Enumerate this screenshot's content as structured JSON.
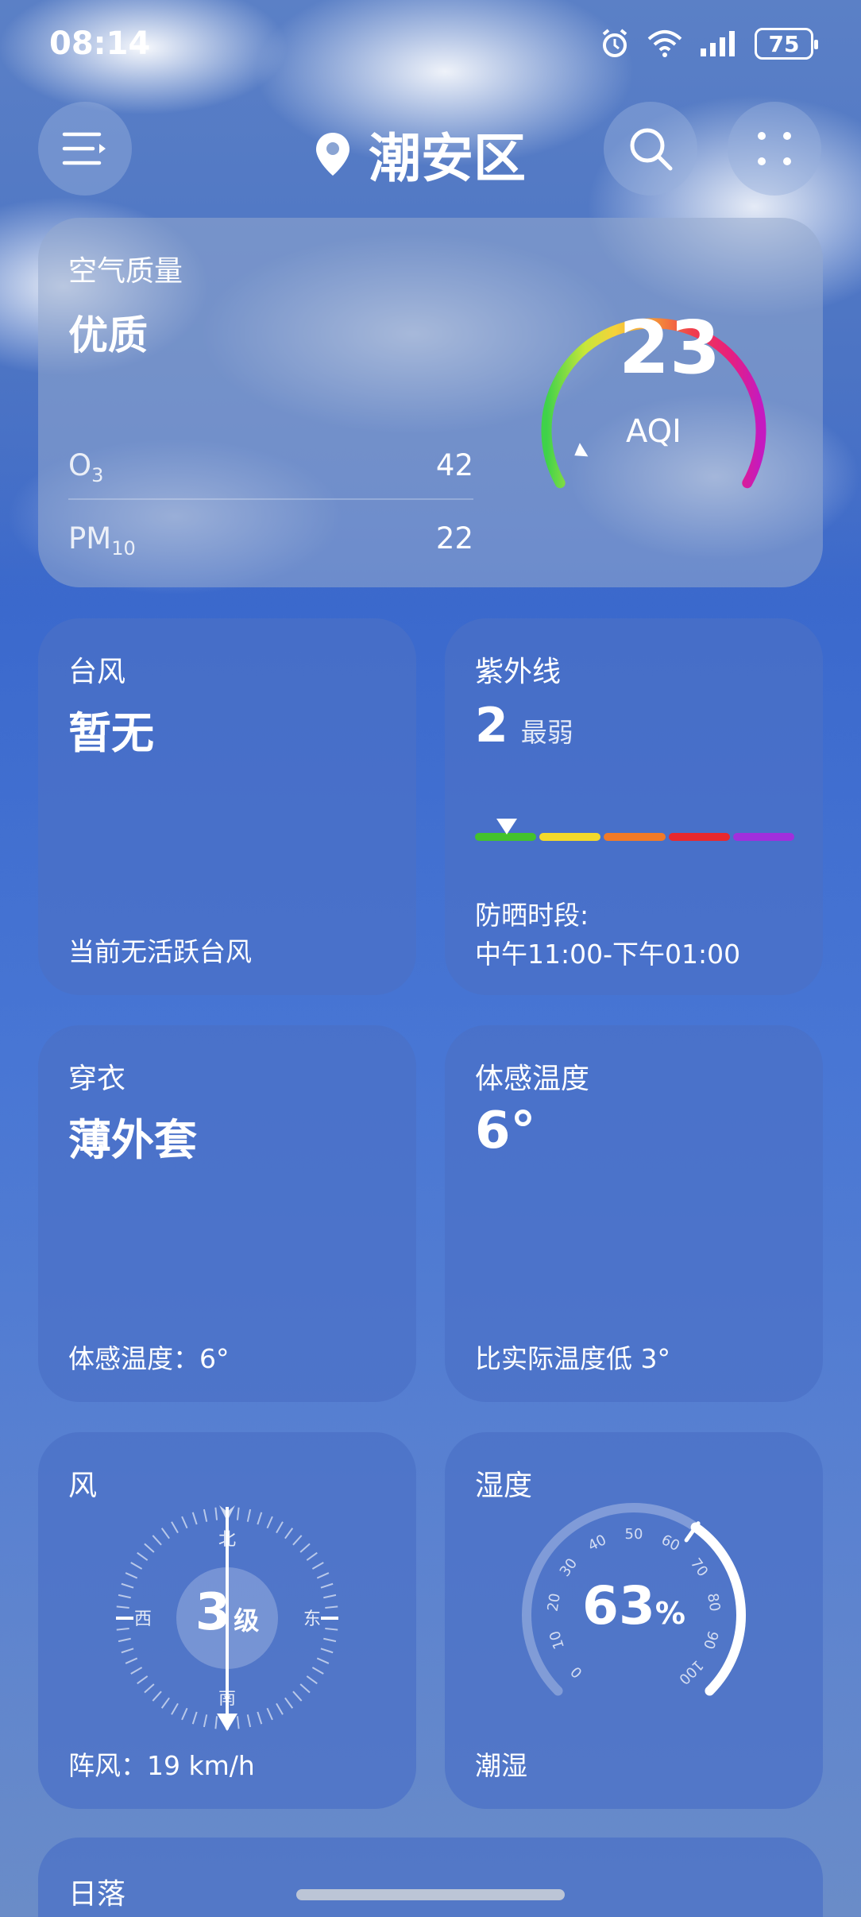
{
  "status": {
    "time": "08:14",
    "battery": "75",
    "icons": [
      "alarm-icon",
      "wifi-icon",
      "signal-icon",
      "battery-icon"
    ]
  },
  "header": {
    "location": "潮安区",
    "icons": [
      "menu-icon",
      "location-pin-icon",
      "search-icon",
      "more-icon"
    ]
  },
  "air_quality": {
    "title": "空气质量",
    "status": "优质",
    "aqi": "23",
    "aqi_label": "AQI",
    "aqi_fraction": 0.05,
    "pollutants": [
      {
        "name": "O",
        "sub": "3",
        "value": "42"
      },
      {
        "name": "PM",
        "sub": "10",
        "value": "22"
      }
    ]
  },
  "typhoon": {
    "title": "台风",
    "status": "暂无",
    "desc": "当前无活跃台风"
  },
  "uv": {
    "title": "紫外线",
    "value": "2",
    "level": "最弱",
    "scale_position": 0.1,
    "scale_colors": [
      "#43c22c",
      "#f3d92a",
      "#f17a28",
      "#e8282e",
      "#a12fdc"
    ],
    "sun_label": "防晒时段:",
    "sun_time": "中午11:00-下午01:00"
  },
  "clothing": {
    "title": "穿衣",
    "value": "薄外套",
    "desc": "体感温度：6°"
  },
  "feels_like": {
    "title": "体感温度",
    "value": "6°",
    "desc": "比实际温度低 3°"
  },
  "wind": {
    "title": "风",
    "level": "3",
    "level_unit": "级",
    "directions": {
      "n": "北",
      "s": "南",
      "e": "东",
      "w": "西"
    },
    "gust": "阵风：19 km/h"
  },
  "humidity": {
    "title": "湿度",
    "value": "63",
    "unit": "%",
    "fraction": 0.63,
    "ticks": [
      "0",
      "10",
      "20",
      "30",
      "40",
      "50",
      "60",
      "70",
      "80",
      "90",
      "100"
    ],
    "desc": "潮湿"
  },
  "sunset": {
    "title": "日落"
  }
}
